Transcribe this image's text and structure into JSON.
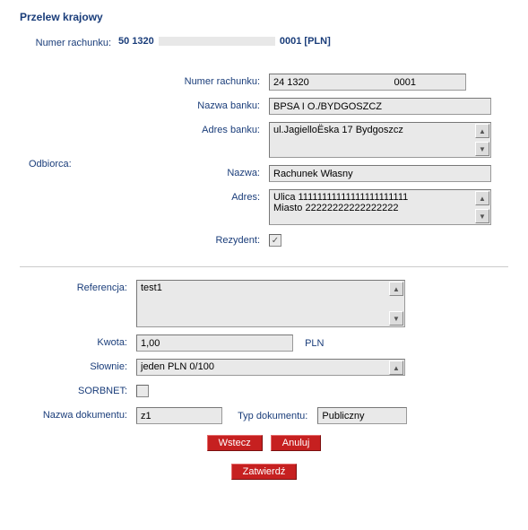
{
  "title": "Przelew krajowy",
  "account": {
    "label": "Numer rachunku:",
    "prefix": "50 1320",
    "suffix": "0001 [PLN]"
  },
  "odbiorca_label": "Odbiorca:",
  "recipient": {
    "account_label": "Numer rachunku:",
    "account_value": "24 1320                               0001",
    "bank_name_label": "Nazwa banku:",
    "bank_name_value": "BPSA I O./BYDGOSZCZ",
    "bank_addr_label": "Adres banku:",
    "bank_addr_value": "ul.JagielloËska 17 Bydgoszcz",
    "name_label": "Nazwa:",
    "name_value": "Rachunek Własny",
    "addr_label": "Adres:",
    "addr_value": "Ulica  11111111111111111111111\nMiasto 22222222222222222",
    "resident_label": "Rezydent:",
    "resident_checked": true
  },
  "details": {
    "reference_label": "Referencja:",
    "reference_value": "test1",
    "amount_label": "Kwota:",
    "amount_value": "1,00",
    "currency": "PLN",
    "words_label": "Słownie:",
    "words_value": "jeden PLN 0/100",
    "sorbnet_label": "SORBNET:",
    "sorbnet_checked": false,
    "docname_label": "Nazwa dokumentu:",
    "docname_value": "z1",
    "doctype_label": "Typ dokumentu:",
    "doctype_value": "Publiczny"
  },
  "buttons": {
    "back": "Wstecz",
    "cancel": "Anuluj",
    "confirm": "Zatwierdź"
  }
}
